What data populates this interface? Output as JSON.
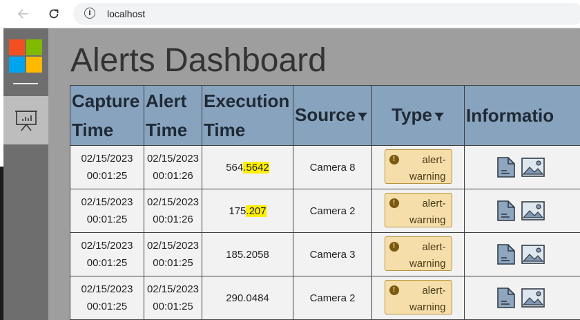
{
  "browser": {
    "url": "localhost"
  },
  "page": {
    "title": "Alerts Dashboard"
  },
  "table": {
    "headers": [
      {
        "label_1": "Capture",
        "label_2": "Time"
      },
      {
        "label_1": "Alert",
        "label_2": "Time"
      },
      {
        "label_1": "Execution",
        "label_2": "Time"
      },
      {
        "label": "Source"
      },
      {
        "label": "Type"
      },
      {
        "label": "Informatio"
      }
    ],
    "rows": [
      {
        "capture_date": "02/15/2023",
        "capture_time": "00:01:25",
        "alert_date": "02/15/2023",
        "alert_time": "00:01:26",
        "exec_a": "564",
        "exec_b": ".5642",
        "source": "Camera 8",
        "type_1": "alert-",
        "type_2": "warning"
      },
      {
        "capture_date": "02/15/2023",
        "capture_time": "00:01:25",
        "alert_date": "02/15/2023",
        "alert_time": "00:01:26",
        "exec_a": "175",
        "exec_b": ".207",
        "source": "Camera 2",
        "type_1": "alert-",
        "type_2": "warning"
      },
      {
        "capture_date": "02/15/2023",
        "capture_time": "00:01:25",
        "alert_date": "02/15/2023",
        "alert_time": "00:01:25",
        "exec_a": "185.2058",
        "exec_b": "",
        "source": "Camera 3",
        "type_1": "alert-",
        "type_2": "warning"
      },
      {
        "capture_date": "02/15/2023",
        "capture_time": "00:01:25",
        "alert_date": "02/15/2023",
        "alert_time": "00:01:25",
        "exec_a": "290.0484",
        "exec_b": "",
        "source": "Camera 2",
        "type_1": "alert-",
        "type_2": "warning"
      }
    ]
  },
  "icons": {
    "back": "arrow-left-icon",
    "reload": "reload-icon",
    "site_info": "info-icon",
    "logo": "microsoft-logo",
    "nav_item": "presentation-chart-icon",
    "filter": "funnel-icon",
    "warning": "exclamation-icon",
    "document": "document-icon",
    "image": "image-icon"
  },
  "colors": {
    "header_bg": "#88a3bd",
    "badge_bg": "#f6deaa",
    "highlight": "#ffee00",
    "logo_red": "#f25022",
    "logo_green": "#7fba00",
    "logo_blue": "#00a4ef",
    "logo_yellow": "#ffb900"
  }
}
